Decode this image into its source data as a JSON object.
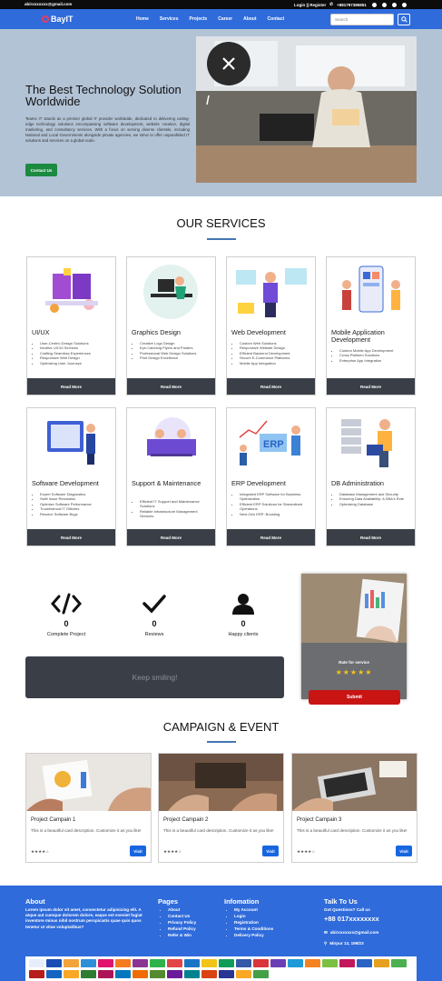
{
  "topbar": {
    "email": "abirxxxxxxx@gmail.com",
    "login": "Login || Register",
    "phone": "+881797386851"
  },
  "nav": {
    "brand": "BayIT",
    "links": [
      "Home",
      "Services",
      "Projects",
      "Career",
      "About",
      "Contact"
    ],
    "search_placeholder": "Search"
  },
  "hero": {
    "title": "The Best Technology Solution Worldwide",
    "text": "Teams IT stands as a premier global IT provider worldwide, dedicated to delivering cutting-edge technology solutions encompassing software development, website creation, digital marketing, and consultancy services. With a focus on serving diverse clientele, including National and Local Governments alongside private agencies, we strive to offer unparalleled IT solutions and services on a global scale.",
    "button": "Contact Us"
  },
  "services": {
    "heading": "OUR SERVICES",
    "read_more": "Read More",
    "items": [
      {
        "title": "UI/UX",
        "points": [
          "User-Centric Design Solutions",
          "Intuitive UX/UI Services",
          "Crafting Seamless Experiences",
          "Responsive Web Design",
          "Optimizing User Journeys"
        ]
      },
      {
        "title": "Graphics Design",
        "points": [
          "Creative Logo Design",
          "Eye-Catching Flyers and Posters",
          "Professional Web Design Solutions",
          "Print Design Excellence"
        ]
      },
      {
        "title": "Web Development",
        "points": [
          "Custom Web Solutions",
          "Responsive Website Design",
          "Efficient Backend Development",
          "Secure E-Commerce Platforms",
          "Mobile App Integration"
        ]
      },
      {
        "title": "Mobile Application Development",
        "points": [
          "Custom Mobile App Development",
          "Cross-Platform Solutions",
          "Enterprise App Integration"
        ]
      },
      {
        "title": "Software Development",
        "points": [
          "Expert Software Diagnostics",
          "Swift Issue Resolution",
          "Optimize Software Performance",
          "Troubleshoot IT Glitches",
          "Resolve Software Bugs"
        ]
      },
      {
        "title": "Support & Maintenance",
        "points": [
          "Efficient IT Support and Maintenance Solutions",
          "Reliable Infrastructure Management Services"
        ]
      },
      {
        "title": "ERP Development",
        "points": [
          "Integrated ERP Software for Business Optimization",
          "Efficient ERP Solutions for Streamlined Operations",
          "Next-Gen ERP: Boosting"
        ]
      },
      {
        "title": "DB Administration",
        "points": [
          "Database Management and Security",
          "Ensuring Data Availability: A DBA's Role",
          "Optimizing Database"
        ]
      }
    ]
  },
  "stats": [
    {
      "icon": "code-icon",
      "value": "0",
      "label": "Complete Project"
    },
    {
      "icon": "check-icon",
      "value": "0",
      "label": "Reviews"
    },
    {
      "icon": "user-icon",
      "value": "0",
      "label": "Happy clients"
    }
  ],
  "smile": "Keep smiling!",
  "rate": {
    "label": "Rate for service",
    "stars": "★★★★★",
    "submit": "Submit"
  },
  "campaign": {
    "heading": "CAMPAIGN & EVENT",
    "visit": "Visit",
    "cards": [
      {
        "title": "Project Campain 1",
        "desc": "This is a beautiful card description. Customize it as you like!",
        "stars": "★★★★☆"
      },
      {
        "title": "Project Campain 2",
        "desc": "This is a beautiful card description. Customize it as you like!",
        "stars": "★★★★☆"
      },
      {
        "title": "Project Campain 3",
        "desc": "This is a beautiful card description. Customize it as you like!",
        "stars": "★★★★☆"
      }
    ]
  },
  "footer": {
    "about_title": "About",
    "about_text": "Lorem ipsum dolor sit amet, consectetur adipisicing elit. A atque aut cumque dolorem dolore, eaque est eveniet fugiat inventore minus nihil nostrum perspiciatis quae quis quos tenetur ut vitae voluptatibus?",
    "pages_title": "Pages",
    "pages": [
      "About",
      "Contact Us",
      "Privacy Policy",
      "Refund Policy",
      "Refer & Win"
    ],
    "info_title": "Infomation",
    "info": [
      "My Account",
      "Login",
      "Registration",
      "Terms & Conditions",
      "Delivery Policy"
    ],
    "talk_title": "Talk To Us",
    "question": "Got Questions? Call us",
    "phone": "+88 017xxxxxxxx",
    "email": "abirxxxxxxx@gmail.com",
    "address": "Mirpur 13, 199/23"
  }
}
